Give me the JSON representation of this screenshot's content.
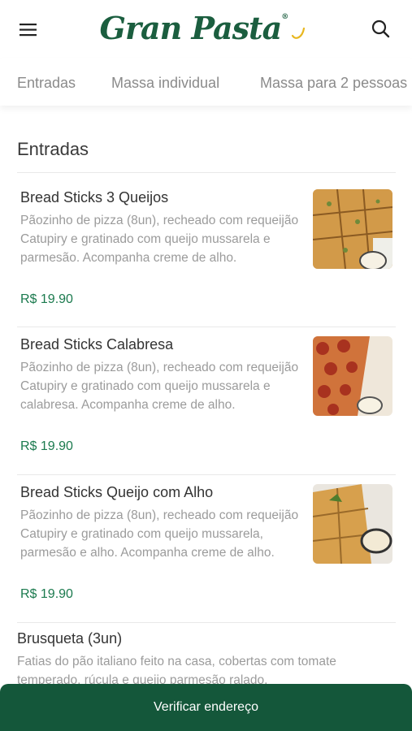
{
  "header": {
    "logo_text": "Gran Pasta",
    "logo_mark": "®",
    "menu_icon": "hamburger-menu-icon",
    "search_icon": "search-icon"
  },
  "tabs": [
    {
      "label": "Entradas"
    },
    {
      "label": "Massa individual"
    },
    {
      "label": "Massa para 2 pessoas"
    }
  ],
  "section": {
    "title": "Entradas"
  },
  "items": [
    {
      "title": "Bread Sticks 3 Queijos",
      "description": "Pãozinho de pizza (8un), recheado com requeijão Catupiry e gratinado com queijo mussarela e parmesão. Acompanha creme de alho.",
      "price": "R$ 19.90"
    },
    {
      "title": "Bread Sticks Calabresa",
      "description": "Pãozinho de pizza (8un), recheado com requeijão Catupiry e gratinado com queijo mussarela e calabresa. Acompanha creme de alho.",
      "price": "R$ 19.90"
    },
    {
      "title": "Bread Sticks Queijo com Alho",
      "description": "Pãozinho de pizza (8un), recheado com requeijão Catupiry e gratinado com queijo mussarela, parmesão e alho. Acompanha creme de alho.",
      "price": "R$ 19.90"
    },
    {
      "title": "Brusqueta (3un)",
      "description": "Fatias do pão italiano feito na casa, cobertas com tomate temperado, rúcula e queijo parmesão ralado."
    }
  ],
  "cta": {
    "label": "Verificar endereço"
  },
  "colors": {
    "brand": "#1b5e3f",
    "price": "#1b7a4e",
    "cta_bg": "#14573a"
  }
}
